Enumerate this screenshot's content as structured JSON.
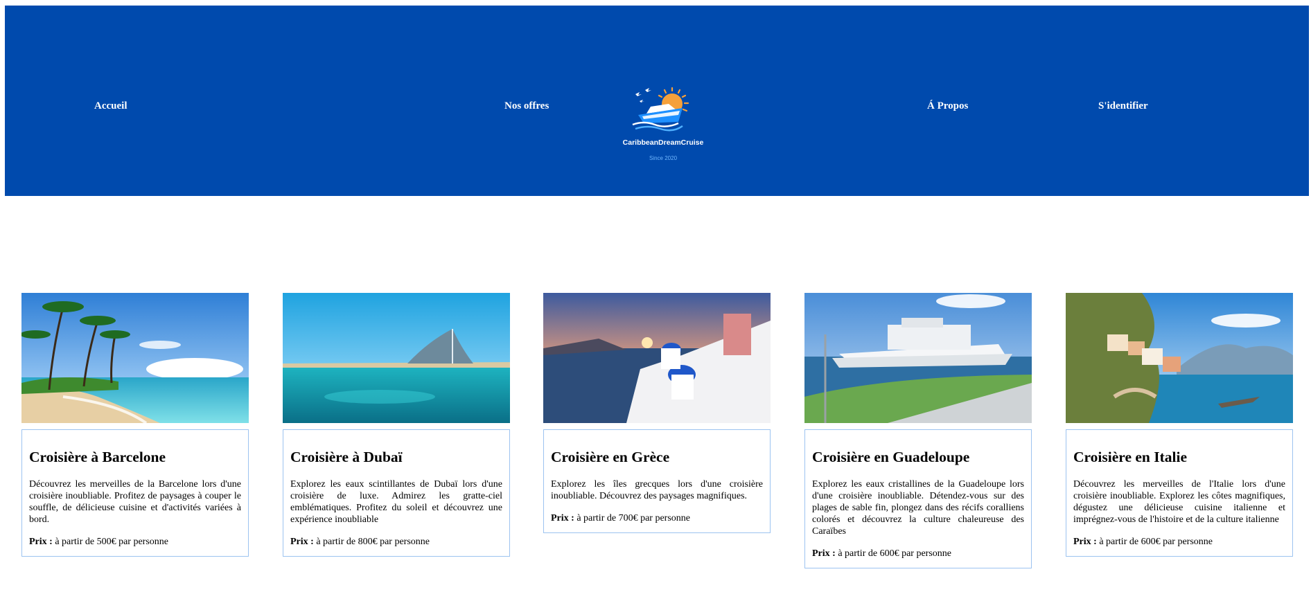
{
  "nav": {
    "home": "Accueil",
    "offers": "Nos offres",
    "about": "Á Propos",
    "login": "S'identifier"
  },
  "brand": {
    "name": "CaribbeanDreamCruise",
    "since": "Since 2020"
  },
  "colors": {
    "header_bg": "#004aad",
    "card_border": "#9cc3f0",
    "since_text": "#6fb7ff"
  },
  "cards": [
    {
      "image": "tropical-beach-palm-trees",
      "title": "Croisière à Barcelone",
      "description": "Découvrez les merveilles de la Barcelone lors d'une croisière inoubliable. Profitez de paysages à couper le souffle, de délicieuse cuisine et d'activités variées à bord.",
      "price_label": "Prix :",
      "price": " à partir de 500€ par personne"
    },
    {
      "image": "dubai-sail-hotel-lagoon",
      "title": "Croisière à Dubaï",
      "description": "Explorez les eaux scintillantes de Dubaï lors d'une croisière de luxe. Admirez les gratte-ciel emblématiques. Profitez du soleil et découvrez une expérience inoubliable",
      "price_label": "Prix :",
      "price": " à partir de 800€ par personne"
    },
    {
      "image": "santorini-sunset-blue-domes",
      "title": "Croisière en Grèce",
      "description": "Explorez les îles grecques lors d'une croisière inoubliable. Découvrez des paysages magnifiques.",
      "price_label": "Prix :",
      "price": " à partir de 700€ par personne"
    },
    {
      "image": "cruise-ship-harbor",
      "title": "Croisière en Guadeloupe",
      "description": "Explorez les eaux cristallines de la Guadeloupe lors d'une croisière inoubliable. Détendez-vous sur des plages de sable fin, plongez dans des récifs coralliens colorés et découvrez la culture chaleureuse des Caraïbes",
      "price_label": "Prix :",
      "price": " à partir de 600€ par personne"
    },
    {
      "image": "amalfi-coast-village",
      "title": "Croisière en Italie",
      "description": "Découvrez les merveilles de l'Italie lors d'une croisière inoubliable. Explorez les côtes magnifiques, dégustez une délicieuse cuisine italienne et imprégnez-vous de l'histoire et de la culture italienne",
      "price_label": "Prix :",
      "price": " à partir de 600€ par personne"
    }
  ]
}
